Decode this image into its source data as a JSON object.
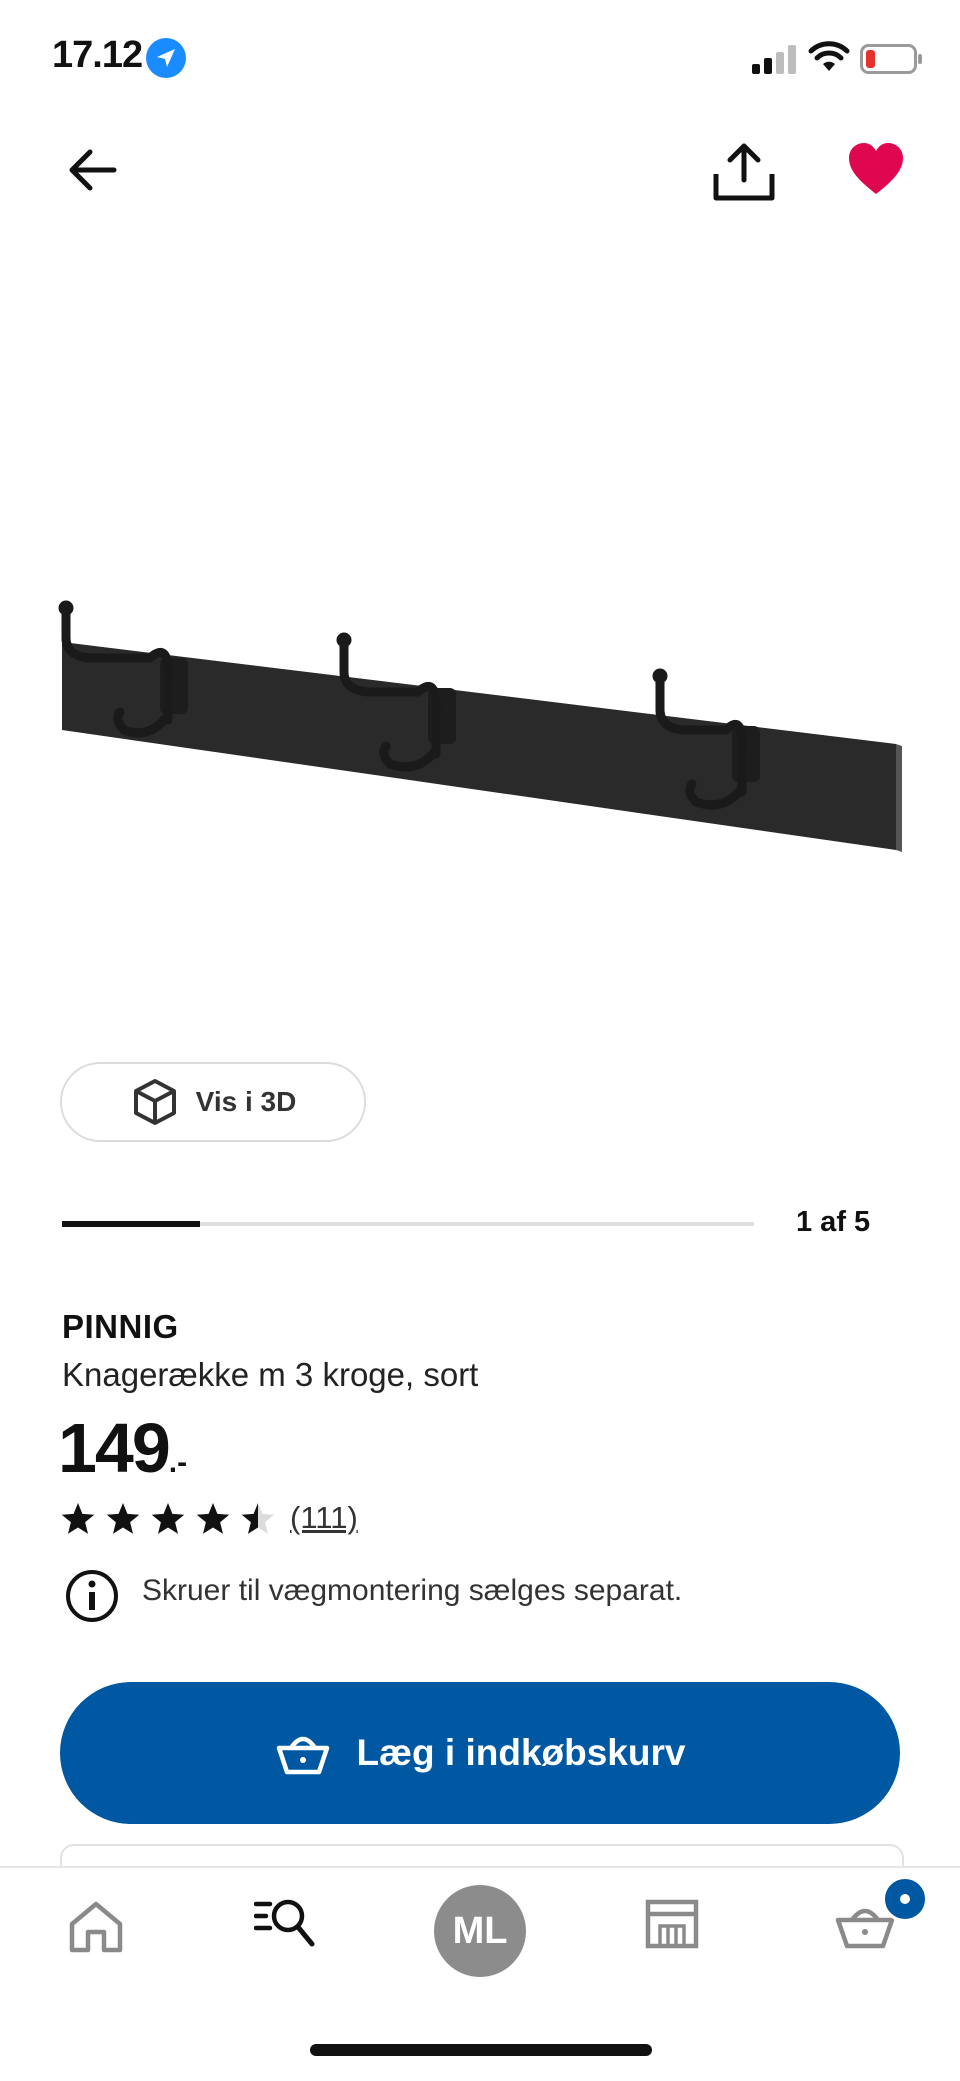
{
  "status_bar": {
    "time": "17.12"
  },
  "top_bar": {
    "back_icon": "arrow-left-icon",
    "share_icon": "share-icon",
    "favorite_icon": "heart-filled-icon",
    "favorite_color": "#e00751"
  },
  "gallery": {
    "view_3d_label": "Vis i 3D",
    "position_label": "1 af 5",
    "current": 1,
    "total": 5
  },
  "product": {
    "name": "PINNIG",
    "description": "Knagerække m 3 kroge, sort",
    "price": "149",
    "price_suffix": ".-",
    "rating": 4.5,
    "rating_max": 5,
    "review_count": "(111)",
    "info_note": "Skruer til vægmontering sælges separat."
  },
  "cta": {
    "add_to_cart_label": "Læg i indkøbskurv",
    "color": "#0058a3"
  },
  "bottom_nav": {
    "items": [
      "home-icon",
      "search-icon",
      "avatar",
      "store-icon",
      "cart-icon"
    ],
    "avatar_initials": "ML"
  }
}
